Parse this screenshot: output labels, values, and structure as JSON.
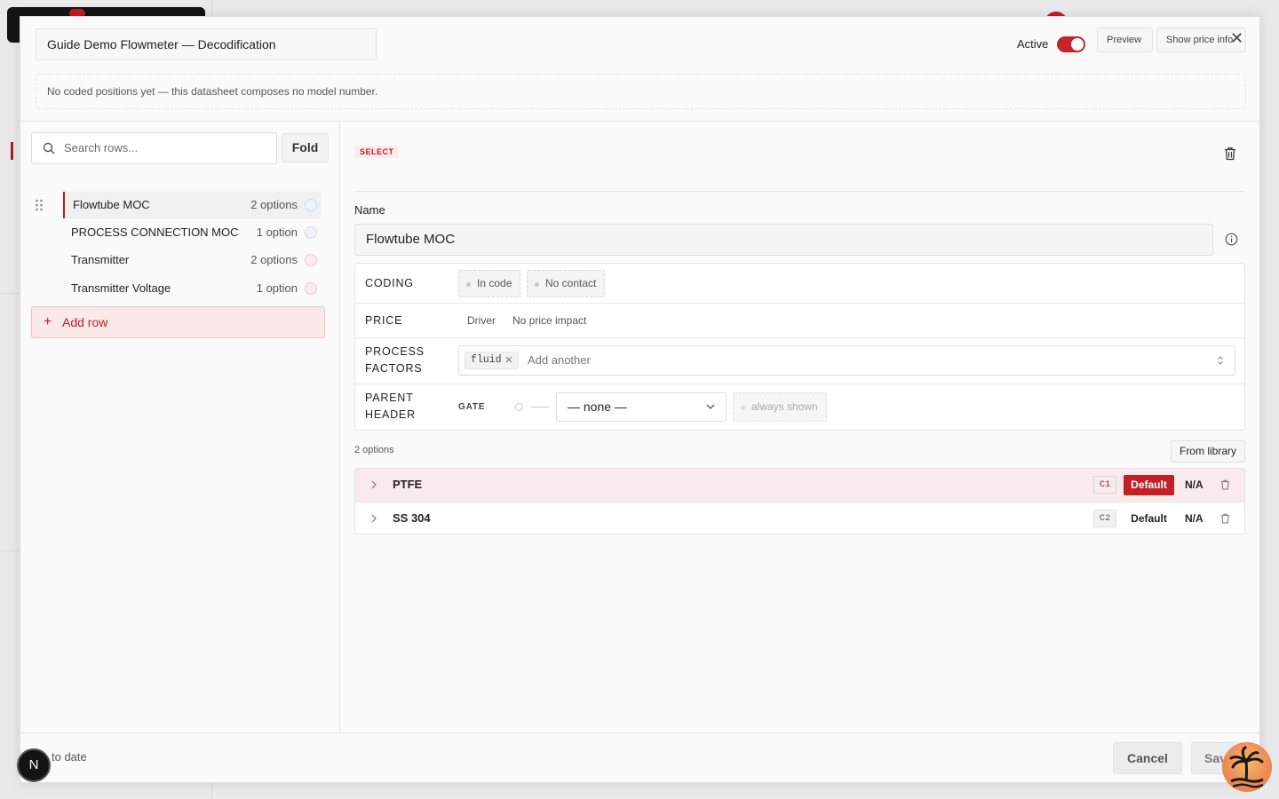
{
  "header": {
    "title": "Guide Demo Flowmeter — Decodification",
    "active_label": "Active",
    "active": true,
    "preview_label": "Preview",
    "price_info_label": "Show price info",
    "close_icon": "close-icon"
  },
  "notice": "No coded positions yet — this datasheet composes no model number.",
  "sidebar": {
    "search_placeholder": "Search rows...",
    "fold_label": "Fold",
    "rows": [
      {
        "label": "Flowtube MOC",
        "count": "2 options",
        "link_color": "blue",
        "selected": true
      },
      {
        "label": "PROCESS CONNECTION MOC",
        "count": "1 option",
        "link_color": "blue",
        "selected": false
      },
      {
        "label": "Transmitter",
        "count": "2 options",
        "link_color": "red",
        "selected": false
      },
      {
        "label": "Transmitter Voltage",
        "count": "1 option",
        "link_color": "red",
        "selected": false
      }
    ],
    "add_row_label": "Add row"
  },
  "detail": {
    "kind_badge": "SELECT",
    "name_label": "Name",
    "name_value": "Flowtube MOC",
    "coding": {
      "key": "CODING",
      "chips": [
        "In code",
        "No contact"
      ]
    },
    "price": {
      "key": "PRICE",
      "driver": "Driver",
      "impact": "No price impact"
    },
    "process_factors": {
      "key": "PROCESS FACTORS",
      "tags": [
        "fluid"
      ],
      "placeholder": "Add another"
    },
    "parent_header": {
      "key": "PARENT HEADER",
      "gate_label": "GATE",
      "select_value": "— none —",
      "visibility": "always shown"
    },
    "options_count": "2 options",
    "from_library_label": "From library",
    "options": [
      {
        "name": "PTFE",
        "code": "C1",
        "default_label": "Default",
        "is_default": true,
        "na_label": "N/A"
      },
      {
        "name": "SS 304",
        "code": "C2",
        "default_label": "Default",
        "is_default": false,
        "na_label": "N/A"
      }
    ]
  },
  "footer": {
    "status": "to date",
    "cancel_label": "Cancel",
    "save_label": "Save"
  },
  "widgets": {
    "n_badge": "N"
  },
  "colors": {
    "accent": "#c21f27",
    "accent_light": "#fbeaeb"
  }
}
